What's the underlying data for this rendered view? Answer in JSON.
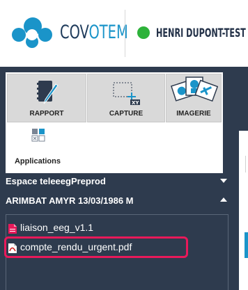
{
  "header": {
    "brand_prefix": "COV",
    "brand_accent": "OTEM",
    "user_name": "HENRI DUPONT-TEST",
    "status_color": "#2db23a"
  },
  "toolbar": {
    "tools": [
      {
        "label": "RAPPORT",
        "icon": "report-pen-icon"
      },
      {
        "label": "CAPTURE",
        "icon": "capture-xy-icon"
      },
      {
        "label": "IMAGERIE",
        "icon": "imagery-icon"
      }
    ],
    "apps_label": "Applications",
    "apps_icon": "applications-grid-icon"
  },
  "sections": [
    {
      "title": "Espace teleeegPreprod",
      "expanded": false
    },
    {
      "title": "ARIMBAT AMYR 13/03/1986 M",
      "expanded": true
    }
  ],
  "files": [
    {
      "name": "liaison_eeg_v1.1",
      "icon": "document-icon"
    },
    {
      "name": "compte_rendu_urgent.pdf",
      "icon": "pdf-icon",
      "highlighted": true
    }
  ],
  "colors": {
    "dark_panel": "#2e3b4e",
    "accent_blue": "#1a94c9",
    "highlight": "#e8195a"
  }
}
